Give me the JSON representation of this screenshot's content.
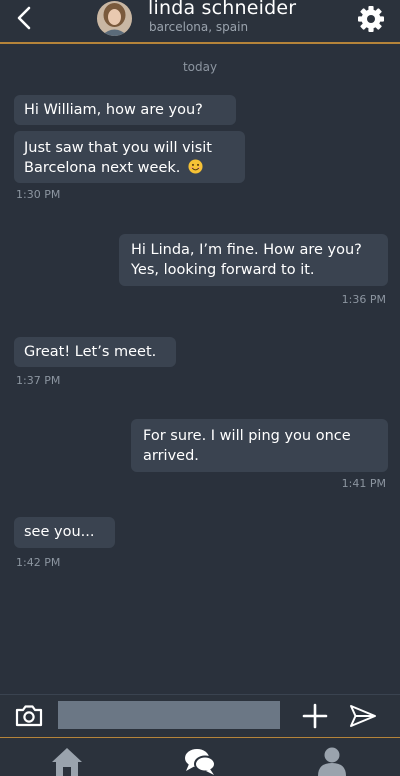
{
  "header": {
    "contact_name": "linda schneider",
    "contact_location": "barcelona, spain",
    "back_icon": "chevron-left-icon",
    "settings_icon": "gear-icon"
  },
  "conversation": {
    "day_label": "today",
    "messages": [
      {
        "direction": "incoming",
        "text": "Hi William, how are you?"
      },
      {
        "direction": "incoming",
        "text": "Just saw that you will visit Barcelona next week.",
        "emoji": "smiling-face-emoji",
        "time": "1:30 PM"
      },
      {
        "direction": "outgoing",
        "text": "Hi Linda, I’m fine. How are you? Yes, looking forward to it.",
        "time": "1:36 PM"
      },
      {
        "direction": "incoming",
        "text": "Great! Let’s meet.",
        "time": "1:37 PM"
      },
      {
        "direction": "outgoing",
        "text": "For sure. I will ping you once arrived.",
        "time": "1:41 PM"
      },
      {
        "direction": "incoming",
        "text": "see you...",
        "time": "1:42 PM"
      }
    ]
  },
  "composer": {
    "input_value": "",
    "input_placeholder": "",
    "camera_icon": "camera-icon",
    "add_icon": "plus-icon",
    "send_icon": "send-icon"
  },
  "bottom_nav": {
    "items": [
      {
        "icon": "home-icon"
      },
      {
        "icon": "chat-bubbles-icon"
      },
      {
        "icon": "user-icon"
      }
    ]
  },
  "colors": {
    "background": "#2a313c",
    "bubble": "#3a4350",
    "accent": "#b5843a",
    "muted_text": "#8c95a0",
    "input": "#6b7785"
  }
}
